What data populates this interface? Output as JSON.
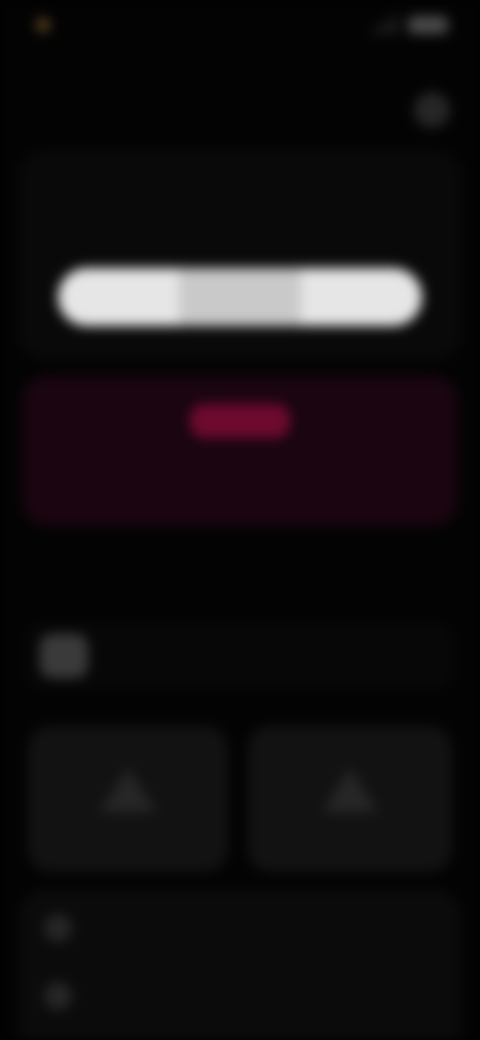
{
  "status_bar": {
    "time": "",
    "left_icon": "record-dot-icon",
    "right_icons": [
      "signal-icon",
      "battery-icon"
    ]
  },
  "header": {
    "left_label": "",
    "right_icon": "profile-icon"
  },
  "top_card": {
    "title": "",
    "segments": [
      "",
      "",
      ""
    ],
    "selected_index": 1
  },
  "red_banner": {
    "pill_label": "",
    "title": "",
    "subtitle": ""
  },
  "section": {
    "title": ""
  },
  "notice": {
    "icon": "notice-avatar-icon",
    "highlight": "",
    "text": ""
  },
  "tiles": [
    {
      "icon": "upload-icon",
      "label": ""
    },
    {
      "icon": "upload-icon",
      "label": ""
    }
  ],
  "bottom_list": {
    "items": [
      {
        "icon": "settings-icon",
        "label": ""
      },
      {
        "icon": "help-icon",
        "label": ""
      }
    ]
  },
  "colors": {
    "background": "#030303",
    "segmented_bg": "#e6e6e6",
    "banner_bg": "#1a0510",
    "banner_pill": "#6e0a2e"
  }
}
